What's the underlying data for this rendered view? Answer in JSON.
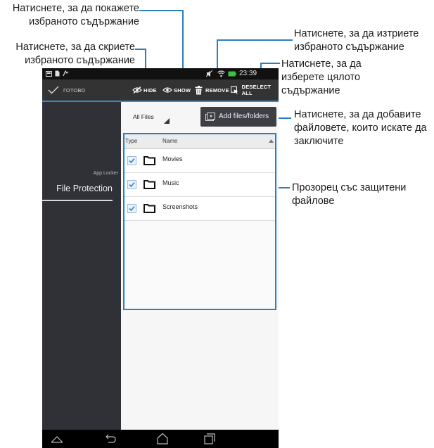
{
  "callouts": {
    "show": [
      "Натиснете, за да покажете",
      "избраното съдържание"
    ],
    "hide": [
      "Натиснете, за да скриете",
      "избраното съдържание"
    ],
    "remove": [
      "Натиснете, за да изтриете",
      "избраното съдържание"
    ],
    "deselect": [
      "Натиснете, за да",
      "изберете цялото",
      "съдържание"
    ],
    "add": [
      "Натиснете, за да добавите",
      "файловете, които искате да",
      "заключите"
    ],
    "window": [
      "Прозорец със защитени",
      "файлове"
    ]
  },
  "status": {
    "time": "23:39"
  },
  "actionbar": {
    "done_label": "ГОТОВО",
    "hide_label": "HIDE",
    "show_label": "SHOW",
    "remove_label": "REMOVE",
    "deselect_label": "DESELECT ALL"
  },
  "sidebar": {
    "section_label": "App Locker",
    "item_label": "File Protection"
  },
  "filter": {
    "selected": "All Files"
  },
  "add_button": {
    "label": "Add files/folders"
  },
  "table": {
    "headers": {
      "type": "Type",
      "name": "Name"
    },
    "rows": [
      {
        "name": "Movies",
        "checked": true
      },
      {
        "name": "Music",
        "checked": true
      },
      {
        "name": "Screenshots",
        "checked": true
      }
    ]
  },
  "colors": {
    "accent": "#2d8fd0",
    "callout_line": "#2a7fc1",
    "sidebar_bg": "#2f3137",
    "actionbar_bg": "#333333"
  }
}
